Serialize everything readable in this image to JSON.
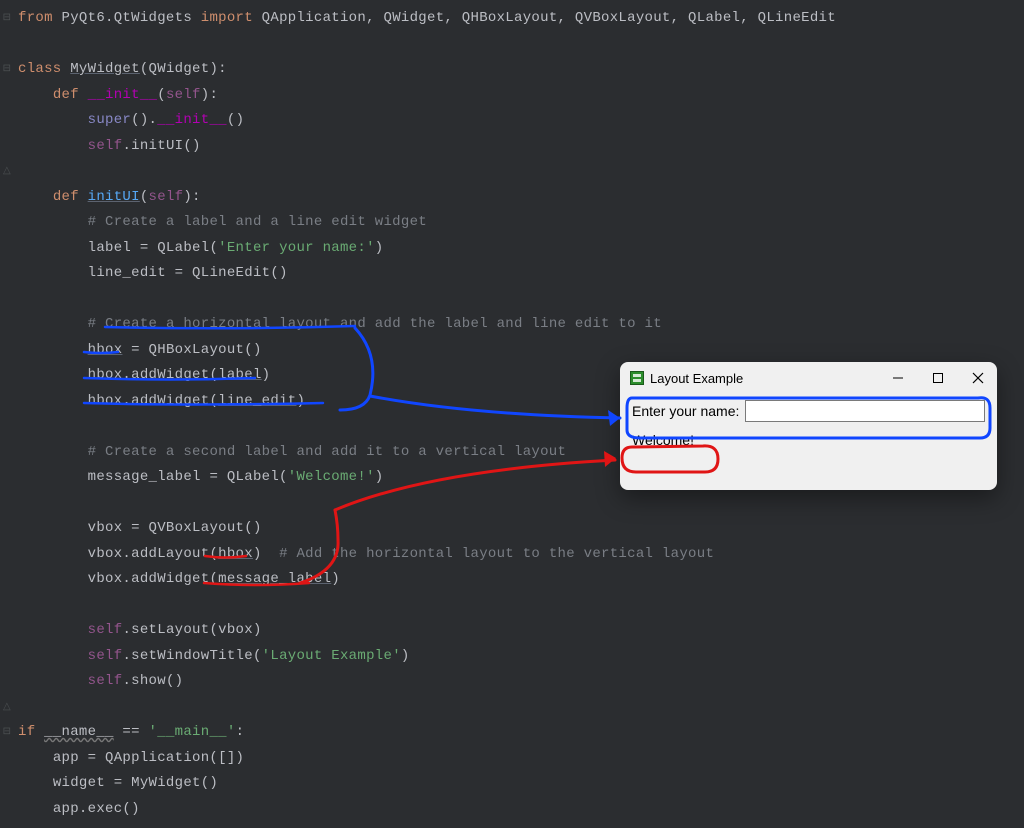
{
  "code": {
    "import_line": {
      "from": "from",
      "module": "PyQt6.QtWidgets",
      "import": "import",
      "names": "QApplication, QWidget, QHBoxLayout, QVBoxLayout, QLabel, QLineEdit"
    },
    "class_decl": {
      "kw": "class",
      "name": "MyWidget",
      "base": "QWidget"
    },
    "init": {
      "def": "def",
      "name": "__init__",
      "self": "self",
      "super_call": "super",
      "dunder_init": "__init__",
      "self_ref": "self",
      "initUI": "initUI"
    },
    "initUI_def": {
      "def": "def",
      "name": "initUI",
      "self": "self"
    },
    "comment1": "# Create a label and a line edit widget",
    "label_assign": {
      "var": "label = QLabel(",
      "str": "'Enter your name:'",
      "close": ")"
    },
    "line_edit_assign": "line_edit = QLineEdit()",
    "comment2_a": "# ",
    "comment2_b": "Create a horizontal layout",
    "comment2_c": " and add the label and line edit to it",
    "hbox_assign": {
      "var": "hbox",
      "rest": " = QHBoxLayout()"
    },
    "hbox_add1": {
      "a": "hbox.addWidget(",
      "b": "label",
      "c": ")"
    },
    "hbox_add2": {
      "a": "hbox.addWidget(",
      "b": "line_edit",
      "c": ")"
    },
    "comment3": "# Create a second label and add it to a vertical layout",
    "msg_assign": {
      "a": "message_label = QLabel(",
      "str": "'Welcome!'",
      "c": ")"
    },
    "vbox_assign": "vbox = QVBoxLayout()",
    "vbox_add1": {
      "a": "vbox.addLayout(",
      "b": "hbox",
      "c": ")",
      "cmt": "  # Add the horizontal layout to the vertical layout"
    },
    "vbox_add2": {
      "a": "vbox.addWidget(",
      "b": "message_label",
      "c": ")"
    },
    "set_layout": {
      "self": "self",
      "rest": ".setLayout(vbox)"
    },
    "set_title": {
      "self": "self",
      "a": ".setWindowTitle(",
      "str": "'Layout Example'",
      "c": ")"
    },
    "show": {
      "self": "self",
      "rest": ".show()"
    },
    "main_guard": {
      "if": "if",
      "name": "__name__",
      "eq": " == ",
      "str": "'__main__'",
      "colon": ":"
    },
    "app_assign": "app = QApplication([])",
    "widget_assign": "widget = MyWidget()",
    "app_exec": "app.exec()"
  },
  "popup": {
    "title": "Layout Example",
    "label": "Enter your name:",
    "input_value": "",
    "message": "Welcome!"
  }
}
